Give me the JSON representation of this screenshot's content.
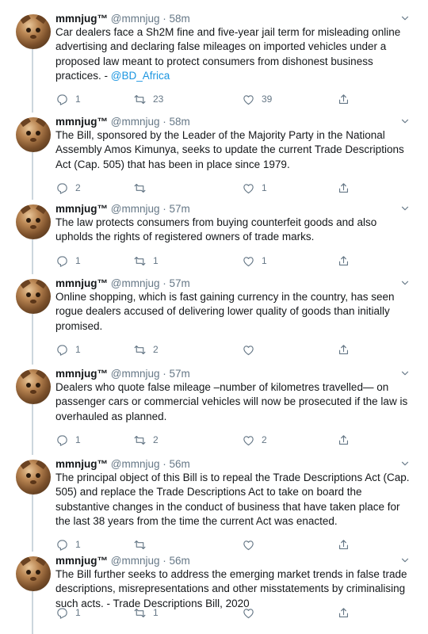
{
  "timeline": {
    "tweets": [
      {
        "name": "mmnjug™",
        "handle": "@mmnjug",
        "separator": "·",
        "time": "58m",
        "text_main": "Car dealers face a Sh2M fine and five-year jail term for misleading online advertising and declaring false mileages on imported vehicles under a proposed law meant to protect consumers from dishonest business practices. - ",
        "text_link": "@BD_Africa",
        "replies": "1",
        "retweets": "23",
        "likes": "39"
      },
      {
        "name": "mmnjug™",
        "handle": "@mmnjug",
        "separator": "·",
        "time": "58m",
        "text_main": "The Bill, sponsored by the Leader of the Majority Party in the National Assembly Amos Kimunya, seeks to update the current Trade Descriptions Act (Cap. 505) that has been in place since 1979.",
        "text_link": "",
        "replies": "2",
        "retweets": "",
        "likes": "1"
      },
      {
        "name": "mmnjug™",
        "handle": "@mmnjug",
        "separator": "·",
        "time": "57m",
        "text_main": "The law protects consumers from buying counterfeit goods and also upholds the rights of registered owners of trade marks.",
        "text_link": "",
        "replies": "1",
        "retweets": "1",
        "likes": "1"
      },
      {
        "name": "mmnjug™",
        "handle": "@mmnjug",
        "separator": "·",
        "time": "57m",
        "text_main": "Online shopping, which is fast gaining currency in the country, has seen rogue dealers accused of delivering lower quality of goods than initially promised.",
        "text_link": "",
        "replies": "1",
        "retweets": "2",
        "likes": ""
      },
      {
        "name": "mmnjug™",
        "handle": "@mmnjug",
        "separator": "·",
        "time": "57m",
        "text_main": "Dealers who quote false mileage –number of kilometres travelled— on passenger cars or commercial vehicles will now be prosecuted if the law is overhauled as planned.",
        "text_link": "",
        "replies": "1",
        "retweets": "2",
        "likes": "2"
      },
      {
        "name": "mmnjug™",
        "handle": "@mmnjug",
        "separator": "·",
        "time": "56m",
        "text_main": "The principal object of this Bill is to repeal the Trade Descriptions Act (Cap. 505) and replace the Trade Descriptions Act to take on board the substantive changes in the conduct of business that have taken place for the last 38 years from the time the current Act was enacted.",
        "text_link": "",
        "replies": "1",
        "retweets": "",
        "likes": ""
      },
      {
        "name": "mmnjug™",
        "handle": "@mmnjug",
        "separator": "·",
        "time": "56m",
        "text_main": "The Bill further seeks to address the emerging market trends in false trade descriptions, misrepresentations and other misstatements by criminalising such acts. - Trade Descriptions Bill, 2020",
        "text_link": "",
        "replies": "1",
        "retweets": "1",
        "likes": ""
      }
    ]
  },
  "icons": {
    "reply": "reply-icon",
    "retweet": "retweet-icon",
    "like": "heart-icon",
    "share": "share-icon",
    "caret": "chevron-down-icon"
  },
  "colors": {
    "text": "#14171a",
    "secondary": "#657786",
    "link": "#1b95e0",
    "thread_line": "#ccd6dd"
  }
}
